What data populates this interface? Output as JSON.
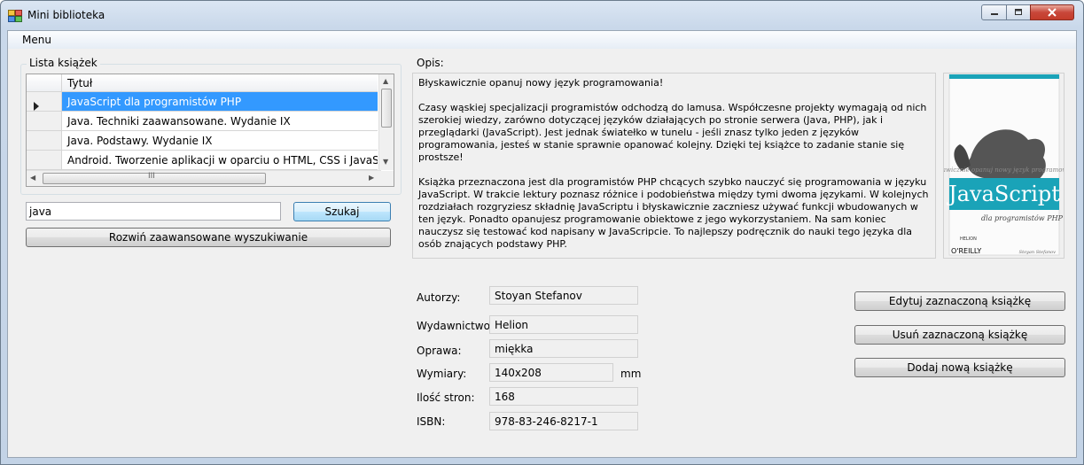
{
  "window": {
    "title": "Mini biblioteka"
  },
  "menu": {
    "items": [
      "Menu"
    ]
  },
  "books_group": {
    "label": "Lista książek",
    "column_header": "Tytuł",
    "rows": [
      "JavaScript dla programistów PHP",
      "Java. Techniki zaawansowane. Wydanie IX",
      "Java. Podstawy. Wydanie IX",
      "Android. Tworzenie aplikacji w oparciu o HTML, CSS i JavaScript"
    ],
    "selected_row": 0
  },
  "search": {
    "value": "java",
    "button": "Szukaj",
    "advanced_button": "Rozwiń zaawansowane wyszukiwanie"
  },
  "description": {
    "label": "Opis:",
    "text": "Błyskawicznie opanuj nowy język programowania!\n\nCzasy wąskiej specjalizacji programistów odchodzą do lamusa. Współczesne projekty wymagają od nich szerokiej wiedzy, zarówno dotyczącej języków działających po stronie serwera (Java, PHP), jak i przeglądarki (JavaScript). Jest jednak światełko w tunelu - jeśli znasz tylko jeden z języków programowania, jesteś w stanie sprawnie opanować kolejny. Dzięki tej książce to zadanie stanie się prostsze!\n\nKsiążka przeznaczona jest dla programistów PHP chcących szybko nauczyć się programowania w języku JavaScript. W trakcie lektury poznasz różnice i podobieństwa między tymi dwoma językami. W kolejnych rozdziałach rozgryziesz składnię JavaScriptu i błyskawicznie zaczniesz używać funkcji wbudowanych w ten język. Ponadto opanujesz programowanie obiektowe z jego wykorzystaniem. Na sam koniec nauczysz się testować kod napisany w JavaScripcie. To najlepszy podręcznik do nauki tego języka dla osób znających podstawy PHP.\n\nDzięki tej książce:"
  },
  "cover": {
    "tagline": "Błyskawicznie opanuj nowy język programowania!",
    "title": "JavaScript",
    "subtitle": "dla programistów PHP",
    "publisher": "HELION",
    "publisher2": "O'REILLY",
    "author": "Stoyan Stefanov"
  },
  "details": {
    "author_label": "Autorzy:",
    "author_value": "Stoyan Stefanov",
    "publisher_label": "Wydawnictwo:",
    "publisher_value": "Helion",
    "binding_label": "Oprawa:",
    "binding_value": "miękka",
    "size_label": "Wymiary:",
    "size_value": "140x208",
    "size_unit": "mm",
    "pages_label": "Ilość stron:",
    "pages_value": "168",
    "isbn_label": "ISBN:",
    "isbn_value": "978-83-246-8217-1"
  },
  "actions": {
    "edit": "Edytuj zaznaczoną książkę",
    "delete": "Usuń zaznaczoną książkę",
    "add": "Dodaj nową książkę"
  },
  "colors": {
    "selection": "#3399ff",
    "cover_accent": "#1aa3b8"
  }
}
